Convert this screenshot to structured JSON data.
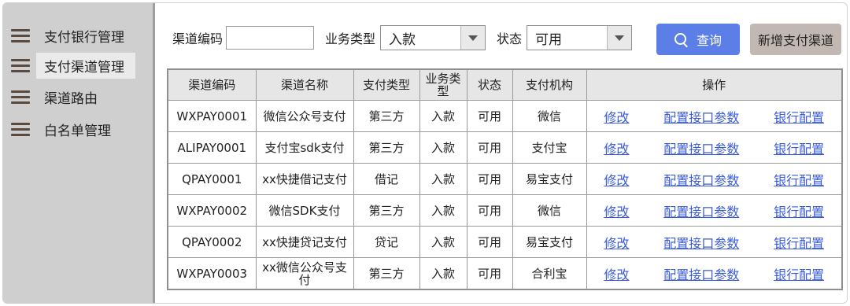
{
  "sidebar": {
    "items": [
      {
        "label": "支付银行管理",
        "active": false
      },
      {
        "label": "支付渠道管理",
        "active": true
      },
      {
        "label": "渠道路由",
        "active": false
      },
      {
        "label": "白名单管理",
        "active": false
      }
    ]
  },
  "filters": {
    "channel_code_label": "渠道编码",
    "channel_code_value": "",
    "biz_type_label": "业务类型",
    "biz_type_value": "入款",
    "status_label": "状态",
    "status_value": "可用",
    "query_label": "查询",
    "add_label": "新增支付渠道"
  },
  "table": {
    "headers": [
      "渠道编码",
      "渠道名称",
      "支付类型",
      "业务类型",
      "状态",
      "支付机构",
      "操作"
    ],
    "action_labels": [
      "修改",
      "配置接口参数",
      "银行配置"
    ],
    "rows": [
      [
        "WXPAY0001",
        "微信公众号支付",
        "第三方",
        "入款",
        "可用",
        "微信"
      ],
      [
        "ALIPAY0001",
        "支付宝sdk支付",
        "第三方",
        "入款",
        "可用",
        "支付宝"
      ],
      [
        "QPAY0001",
        "xx快捷借记支付",
        "借记",
        "入款",
        "可用",
        "易宝支付"
      ],
      [
        "WXPAY0002",
        "微信SDK支付",
        "第三方",
        "入款",
        "可用",
        "微信"
      ],
      [
        "QPAY0002",
        "xx快捷贷记支付",
        "贷记",
        "入款",
        "可用",
        "易宝支付"
      ],
      [
        "WXPAY0003",
        "xx微信公众号支付",
        "第三方",
        "入款",
        "可用",
        "合利宝"
      ]
    ]
  },
  "colors": {
    "accent": "#5b7fe6",
    "add_button": "#c1b8b3",
    "link": "#3a5bd8",
    "sidebar_bg": "#cfcfcf"
  }
}
